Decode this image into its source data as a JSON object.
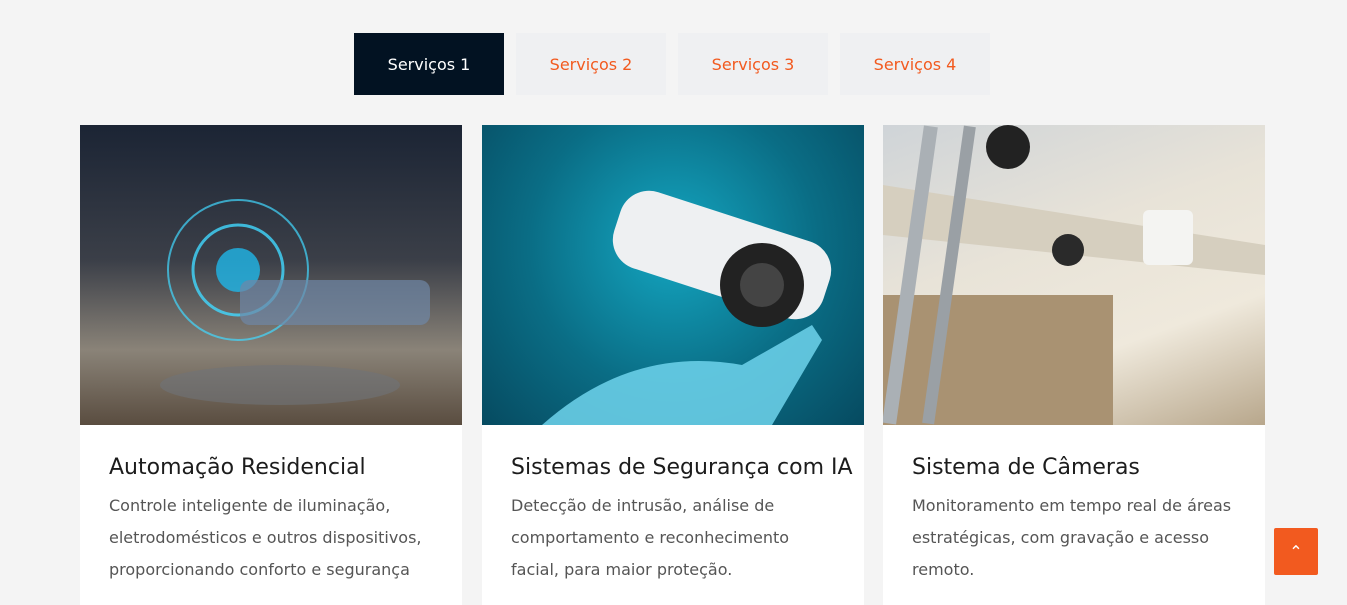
{
  "tabs": [
    {
      "label": "Serviços 1",
      "active": true
    },
    {
      "label": "Serviços 2"
    },
    {
      "label": "Serviços 3"
    },
    {
      "label": "Serviços 4"
    }
  ],
  "cards": [
    {
      "title": "Automação Residencial",
      "text": "Controle inteligente de iluminação, eletrodomésticos e outros dispositivos, proporcionando conforto e segurança"
    },
    {
      "title": "Sistemas de Segurança com IA",
      "text": "Detecção de intrusão, análise de comportamento e reconhecimento facial, para maior proteção."
    },
    {
      "title": "Sistema de Câmeras",
      "text": "Monitoramento em tempo real de áreas estratégicas, com gravação e acesso remoto."
    }
  ],
  "colors": {
    "accent": "#f25a1f",
    "dark": "#021222"
  },
  "back_to_top": {
    "icon": "chevron-up-icon",
    "glyph": "⌃"
  }
}
